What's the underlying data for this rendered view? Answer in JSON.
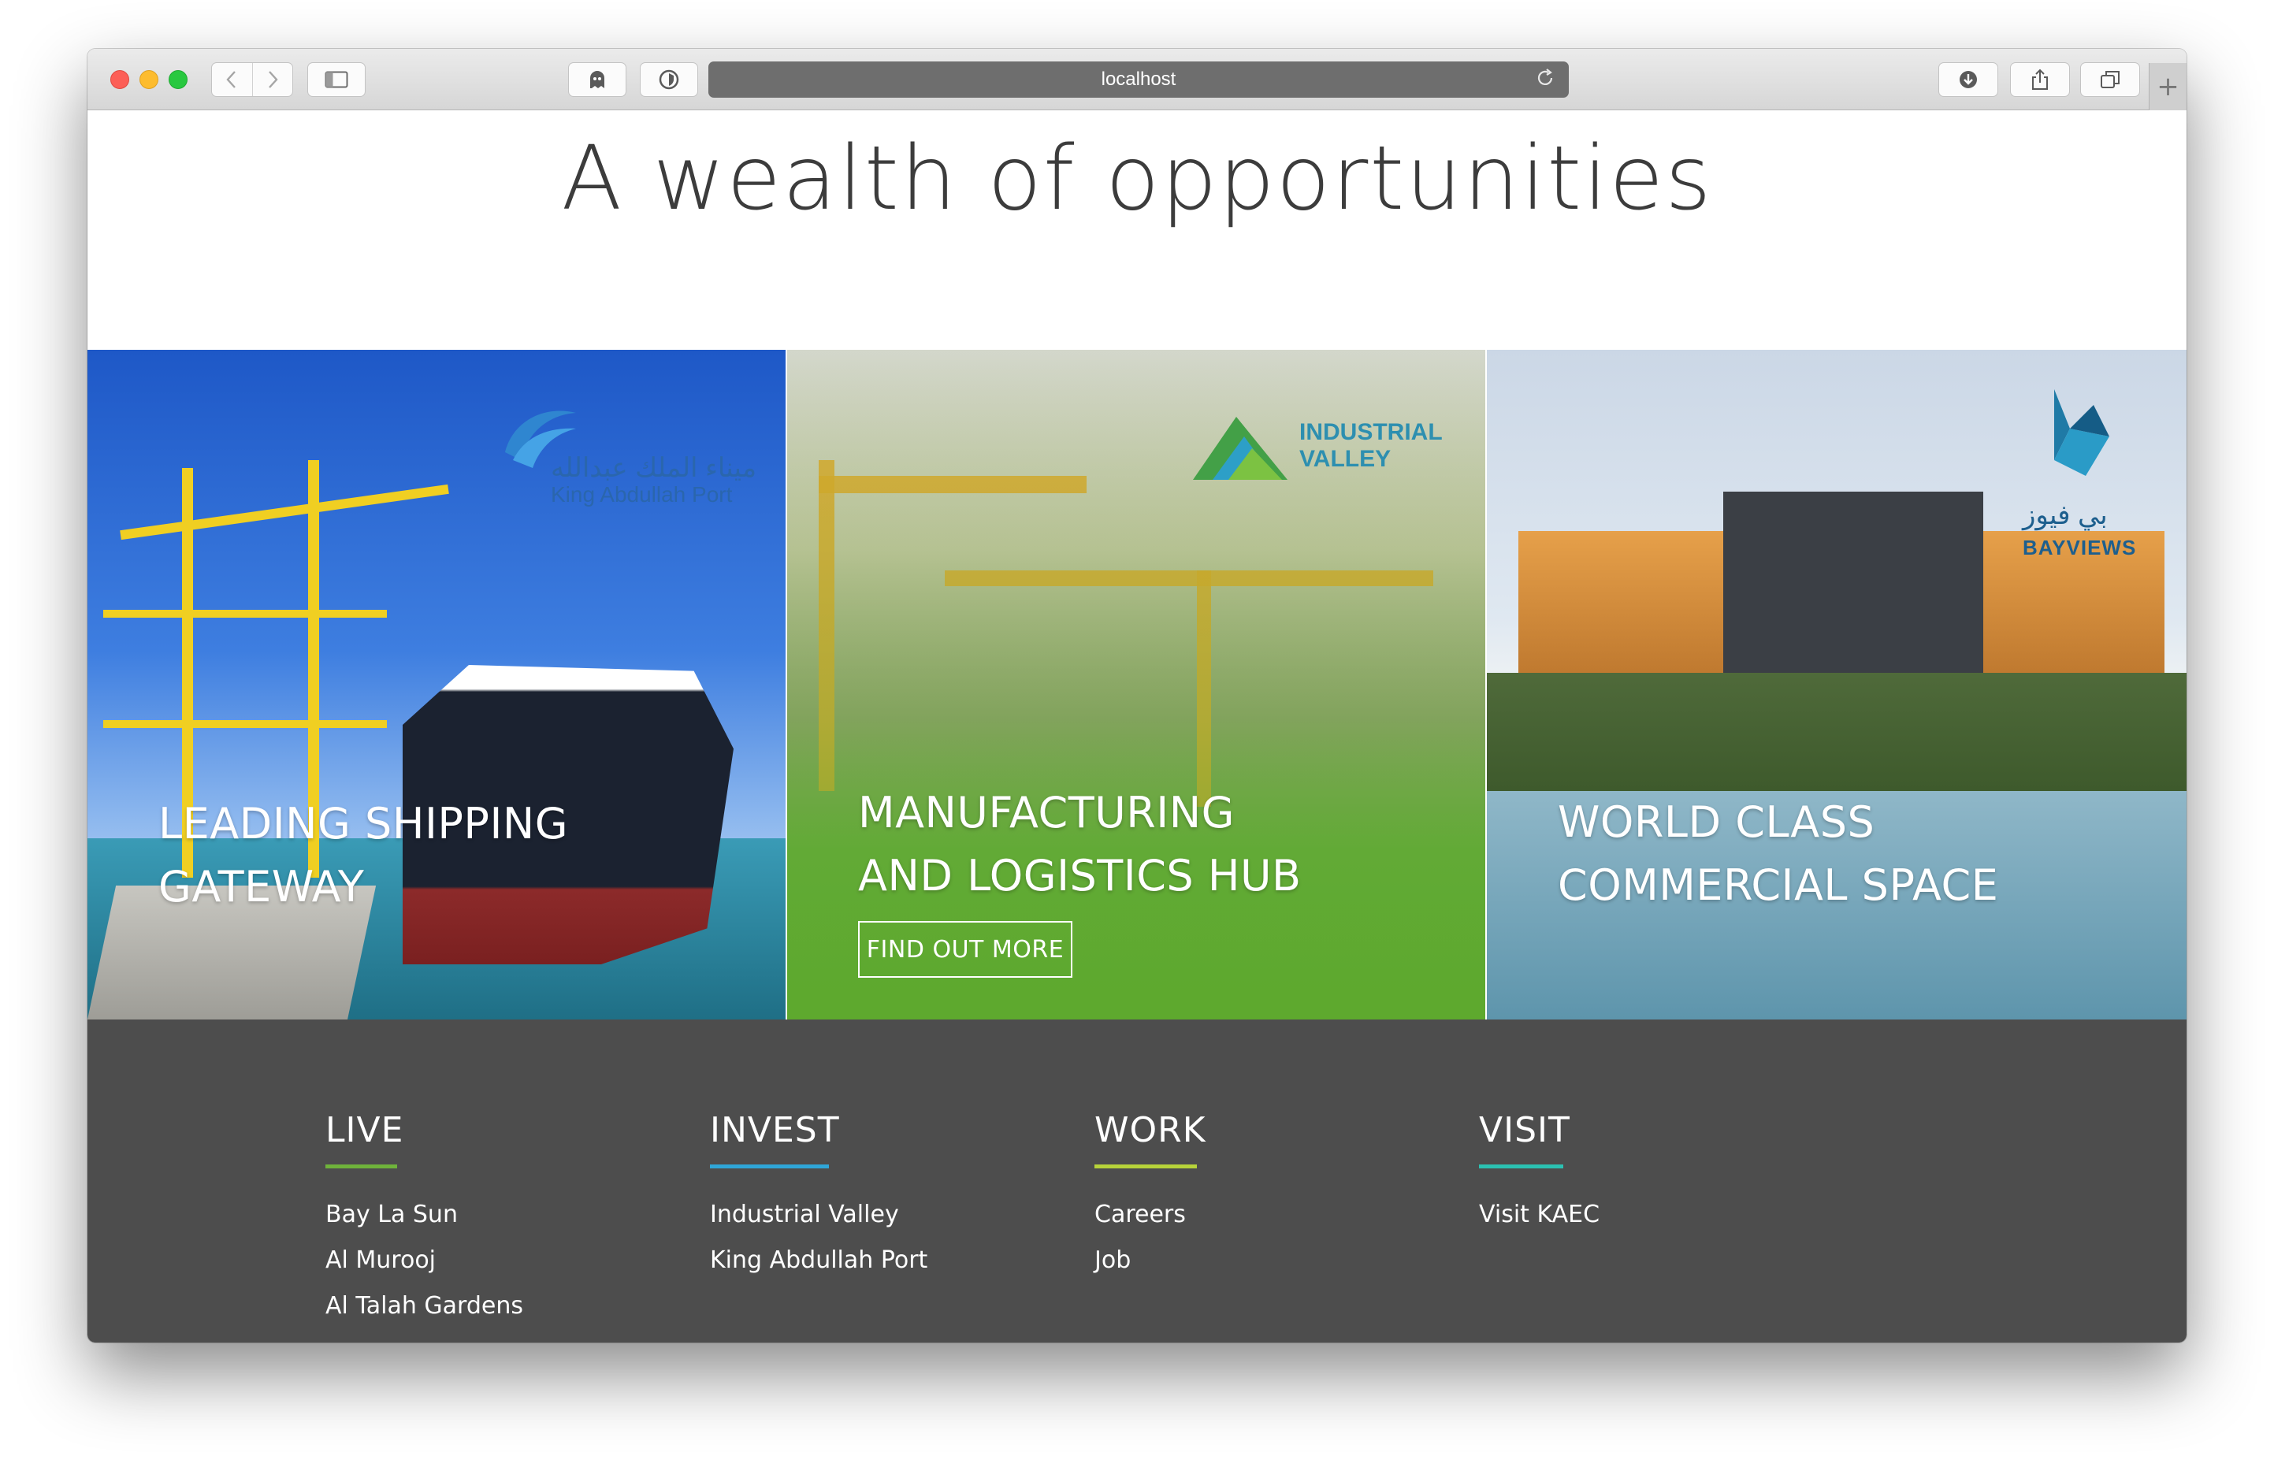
{
  "browser": {
    "url": "localhost",
    "icons": {
      "back": "chevron-left-icon",
      "forward": "chevron-right-icon",
      "sidebar": "sidebar-icon",
      "ghost": "ghost-icon",
      "shield": "shield-icon",
      "reload": "reload-icon",
      "download": "download-icon",
      "share": "share-icon",
      "tabs": "tabs-icon",
      "new_tab": "plus-icon"
    }
  },
  "page": {
    "headline": "A wealth of opportunities"
  },
  "panels": [
    {
      "title_line1": "LEADING SHIPPING",
      "title_line2": "GATEWAY",
      "logo_ar": "ميناء الملك عبدالله",
      "logo_en": "King Abdullah Port"
    },
    {
      "title_line1": "MANUFACTURING",
      "title_line2": "AND LOGISTICS HUB",
      "button": "FIND OUT MORE",
      "logo_en_1": "INDUSTRIAL",
      "logo_en_2": "VALLEY"
    },
    {
      "title_line1": "WORLD CLASS",
      "title_line2": "COMMERCIAL SPACE",
      "logo_ar": "بي فيوز",
      "logo_en": "BAYVIEWS"
    }
  ],
  "footer": {
    "columns": [
      {
        "heading": "LIVE",
        "accent": "#6fb33b",
        "links": [
          "Bay La Sun",
          "Al Murooj",
          "Al Talah Gardens"
        ]
      },
      {
        "heading": "INVEST",
        "accent": "#2fa6d8",
        "links": [
          "Industrial Valley",
          "King Abdullah Port"
        ]
      },
      {
        "heading": "WORK",
        "accent": "#b7d33a",
        "links": [
          "Careers",
          "Job"
        ]
      },
      {
        "heading": "VISIT",
        "accent": "#2bc1b2",
        "links": [
          "Visit KAEC"
        ]
      }
    ]
  }
}
